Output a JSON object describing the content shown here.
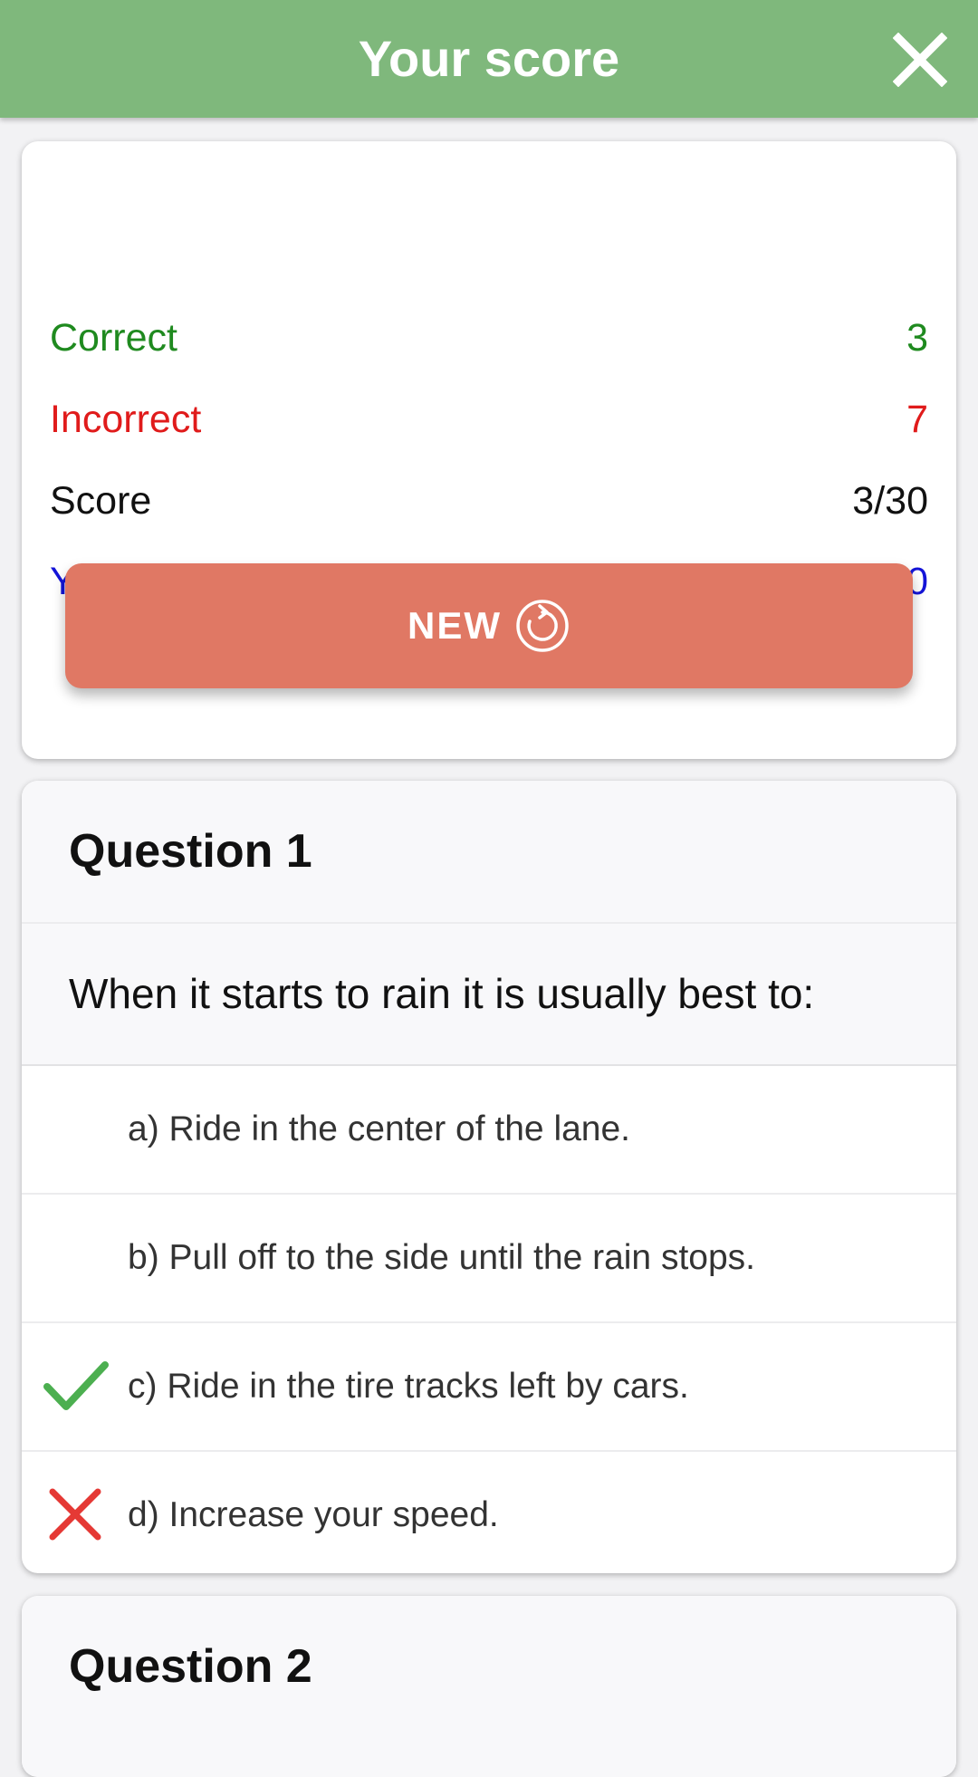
{
  "header": {
    "title": "Your score"
  },
  "stats": [
    {
      "label": "Correct",
      "value": "3",
      "color": "#1f8a1f"
    },
    {
      "label": "Incorrect",
      "value": "7",
      "color": "#e01b1b"
    },
    {
      "label": "Score",
      "value": "3/30",
      "color": "#111111"
    },
    {
      "label": "Your time",
      "value": "1:40",
      "color": "#1414d8"
    }
  ],
  "new_button": {
    "label": "NEW"
  },
  "questions": [
    {
      "title": "Question 1",
      "text": "When it starts to rain it is usually best to:",
      "answers": [
        {
          "text": "a) Ride in the center of the lane.",
          "mark": ""
        },
        {
          "text": "b) Pull off to the side until the rain stops.",
          "mark": ""
        },
        {
          "text": "c) Ride in the tire tracks left by cars.",
          "mark": "correct"
        },
        {
          "text": "d) Increase your speed.",
          "mark": "incorrect"
        }
      ]
    },
    {
      "title": "Question 2"
    }
  ],
  "colors": {
    "header": "#7fb87c",
    "new_button": "#e07864",
    "check": "#4caf50",
    "cross": "#e53935"
  }
}
